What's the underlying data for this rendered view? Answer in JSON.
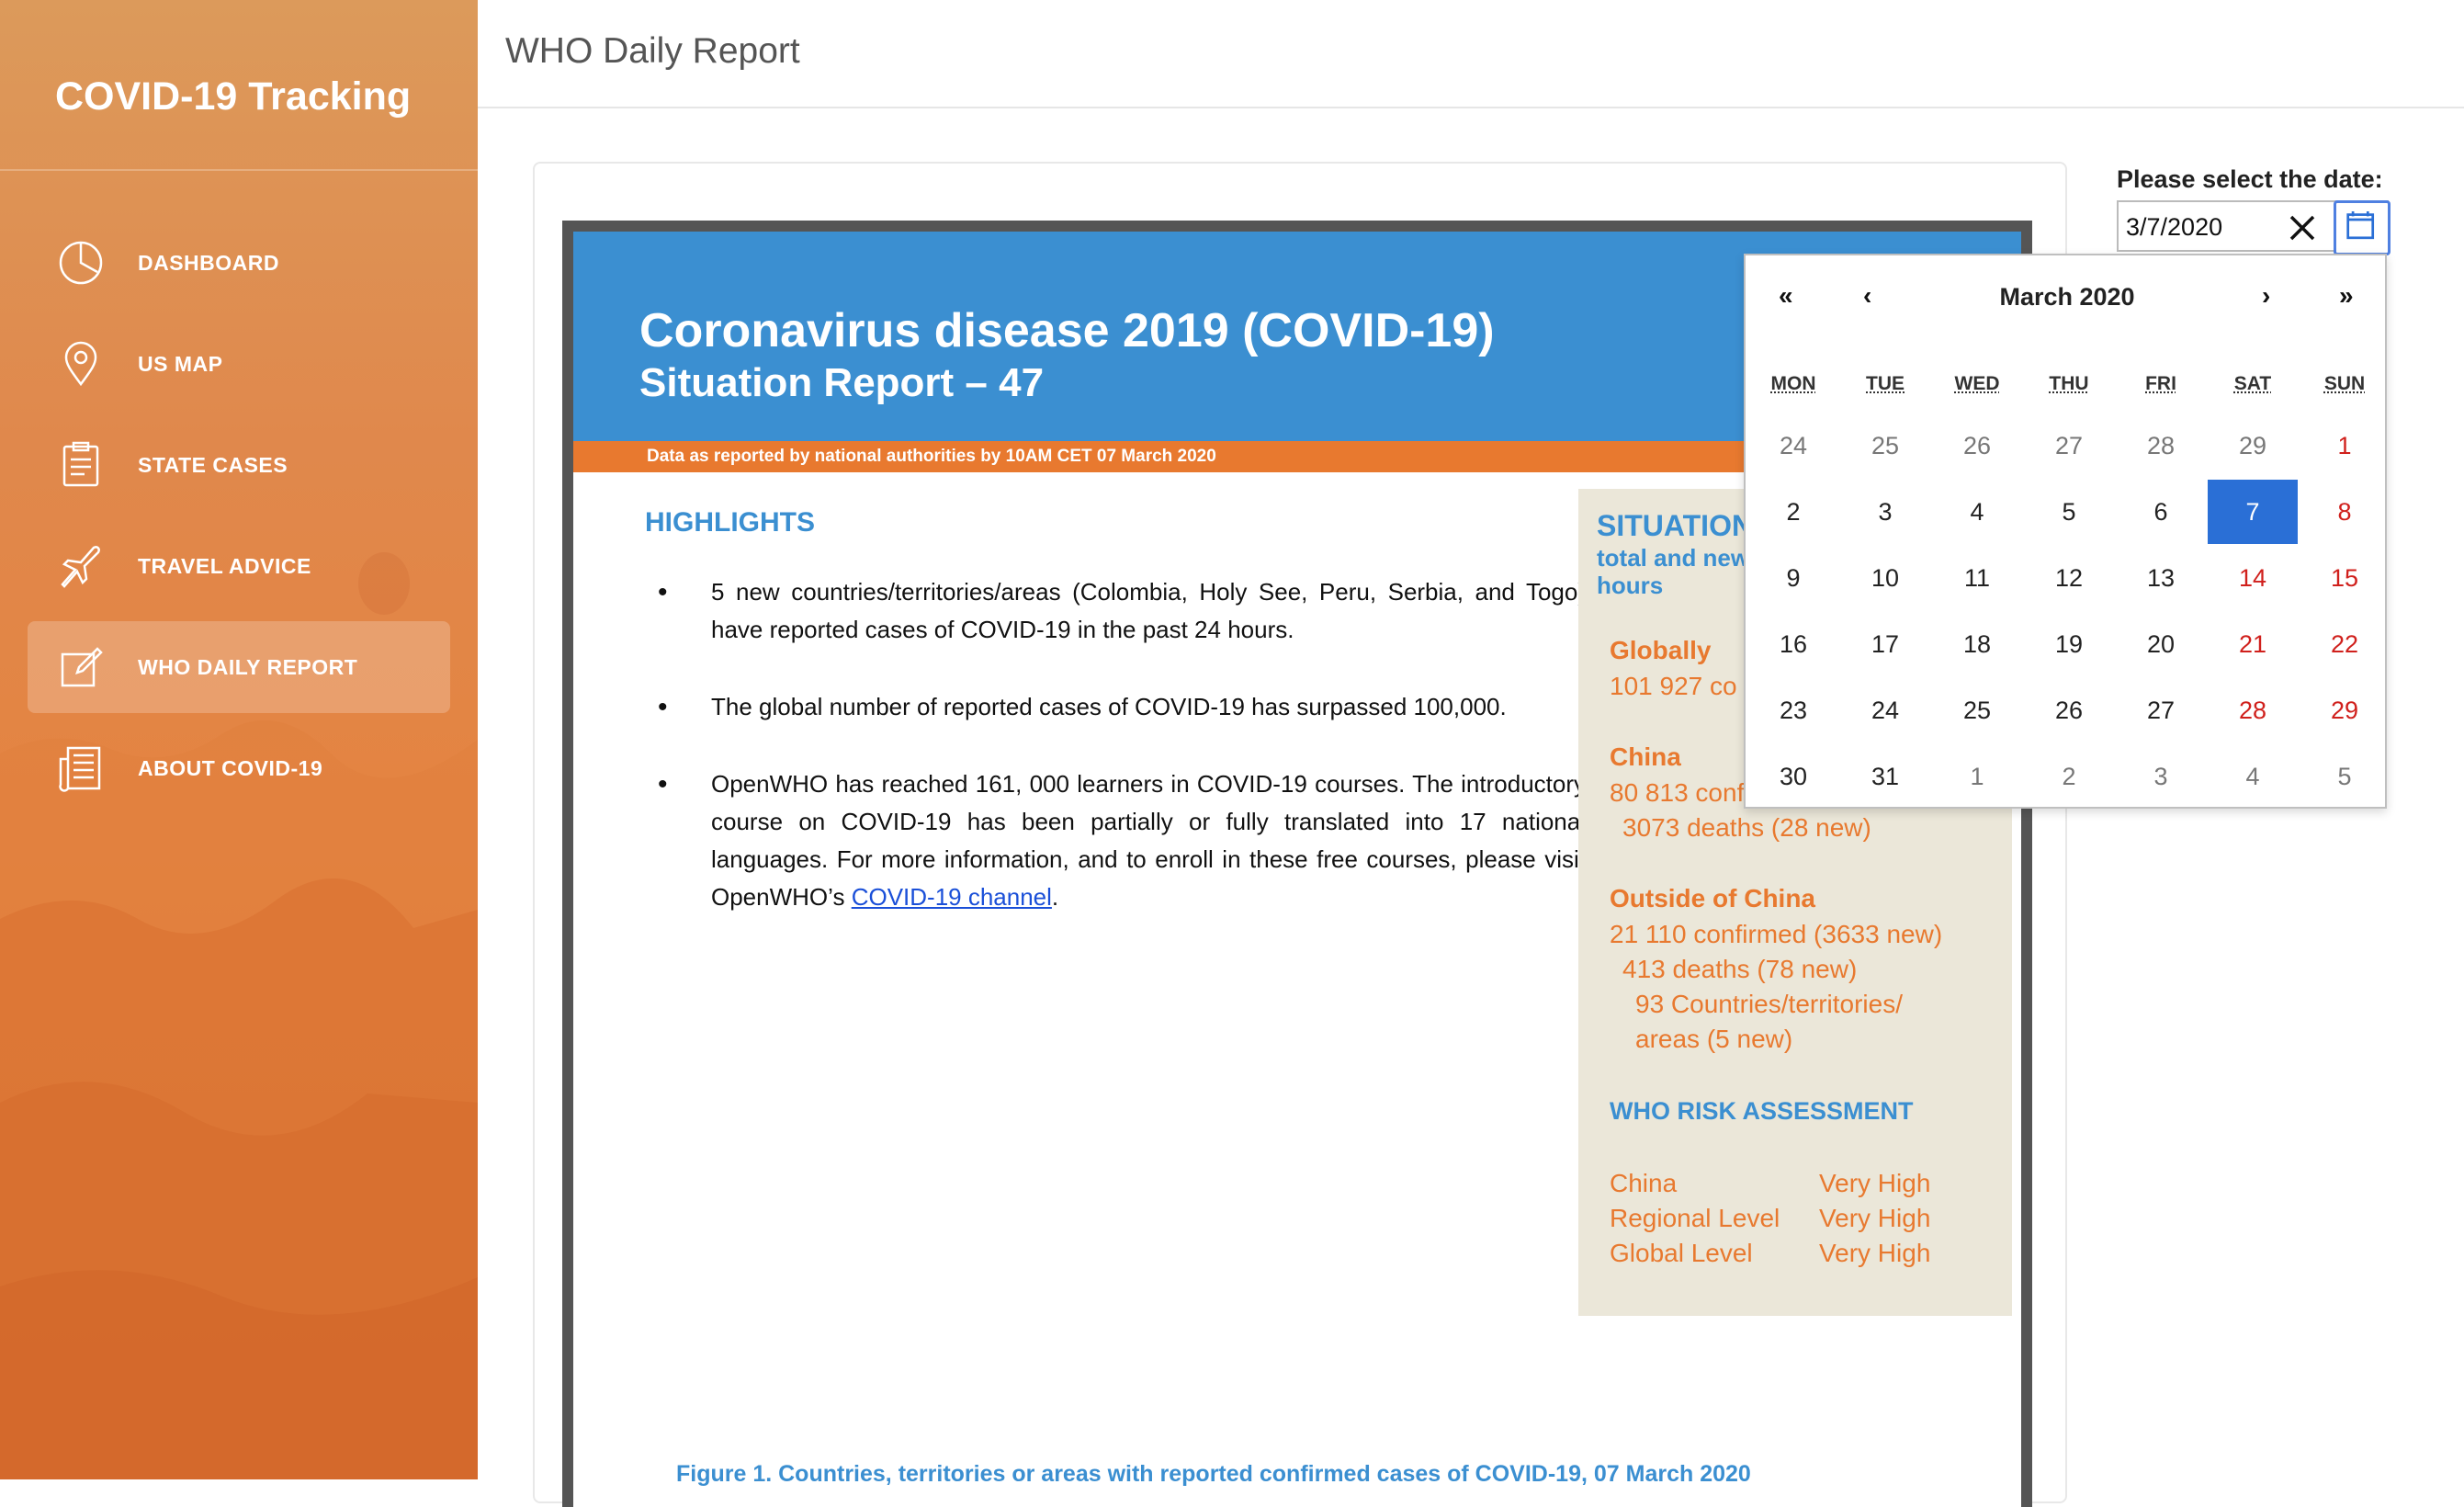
{
  "app": {
    "brand": "COVID-19 Tracking",
    "page_title": "WHO Daily Report"
  },
  "sidebar": {
    "items": [
      {
        "label": "DASHBOARD",
        "icon": "pie-chart-icon",
        "active": false
      },
      {
        "label": "US MAP",
        "icon": "map-pin-icon",
        "active": false
      },
      {
        "label": "STATE CASES",
        "icon": "clipboard-icon",
        "active": false
      },
      {
        "label": "TRAVEL ADVICE",
        "icon": "airplane-icon",
        "active": false
      },
      {
        "label": "WHO DAILY REPORT",
        "icon": "edit-icon",
        "active": true
      },
      {
        "label": "ABOUT COVID-19",
        "icon": "newspaper-icon",
        "active": false
      }
    ]
  },
  "report": {
    "title": "Coronavirus disease 2019 (COVID-19)",
    "subtitle": "Situation Report – 47",
    "strip": "Data as reported by national authorities by 10AM CET 07 March 2020",
    "highlights_title": "HIGHLIGHTS",
    "bullets": [
      "5 new countries/territories/areas (Colombia, Holy See, Peru, Serbia, and Togo) have reported cases of COVID-19 in the past 24 hours.",
      "The global number of reported cases of COVID-19 has surpassed 100,000.",
      "OpenWHO has reached 161, 000 learners in COVID-19 courses. The introductory course on COVID-19 has been partially or fully translated into 17 national languages. For more information, and to enroll in these free courses, please visit OpenWHO’s"
    ],
    "bullet3_link": "COVID-19 channel",
    "bullet3_end": ".",
    "situation": {
      "heading": "SITUATION",
      "subheading": "total and new hours",
      "globally_label": "Globally",
      "globally_text": "101 927 co",
      "china_label": "China",
      "china_confirmed": "80 813 conf",
      "china_deaths": "3073 deaths (28 new)",
      "outside_label": "Outside of China",
      "outside_confirmed": "21 110 confirmed (3633 new)",
      "outside_deaths": "413 deaths (78 new)",
      "outside_countries": "93 Countries/territories/",
      "outside_areas": "areas (5 new)",
      "risk_heading": "WHO RISK ASSESSMENT",
      "risk": [
        {
          "k": "China",
          "v": "Very High"
        },
        {
          "k": "Regional Level",
          "v": "Very High"
        },
        {
          "k": "Global Level",
          "v": "Very High"
        }
      ]
    },
    "figure_caption": "Figure 1. Countries, territories or areas with reported confirmed cases of COVID-19, 07 March 2020"
  },
  "datepicker": {
    "label": "Please select the date:",
    "value": "3/7/2020",
    "month": "March 2020",
    "nav": {
      "prev_year": "«",
      "prev_month": "‹",
      "next_month": "›",
      "next_year": "»"
    },
    "weekdays": [
      "MON",
      "TUE",
      "WED",
      "THU",
      "FRI",
      "SAT",
      "SUN"
    ],
    "weeks": [
      [
        "24",
        "25",
        "26",
        "27",
        "28",
        "29",
        "1"
      ],
      [
        "2",
        "3",
        "4",
        "5",
        "6",
        "7",
        "8"
      ],
      [
        "9",
        "10",
        "11",
        "12",
        "13",
        "14",
        "15"
      ],
      [
        "16",
        "17",
        "18",
        "19",
        "20",
        "21",
        "22"
      ],
      [
        "23",
        "24",
        "25",
        "26",
        "27",
        "28",
        "29"
      ],
      [
        "30",
        "31",
        "1",
        "2",
        "3",
        "4",
        "5"
      ]
    ],
    "selected_day": "7",
    "colors": {
      "accent": "#2a6fd6",
      "weekend": "#d0201c",
      "muted": "#777777"
    }
  }
}
